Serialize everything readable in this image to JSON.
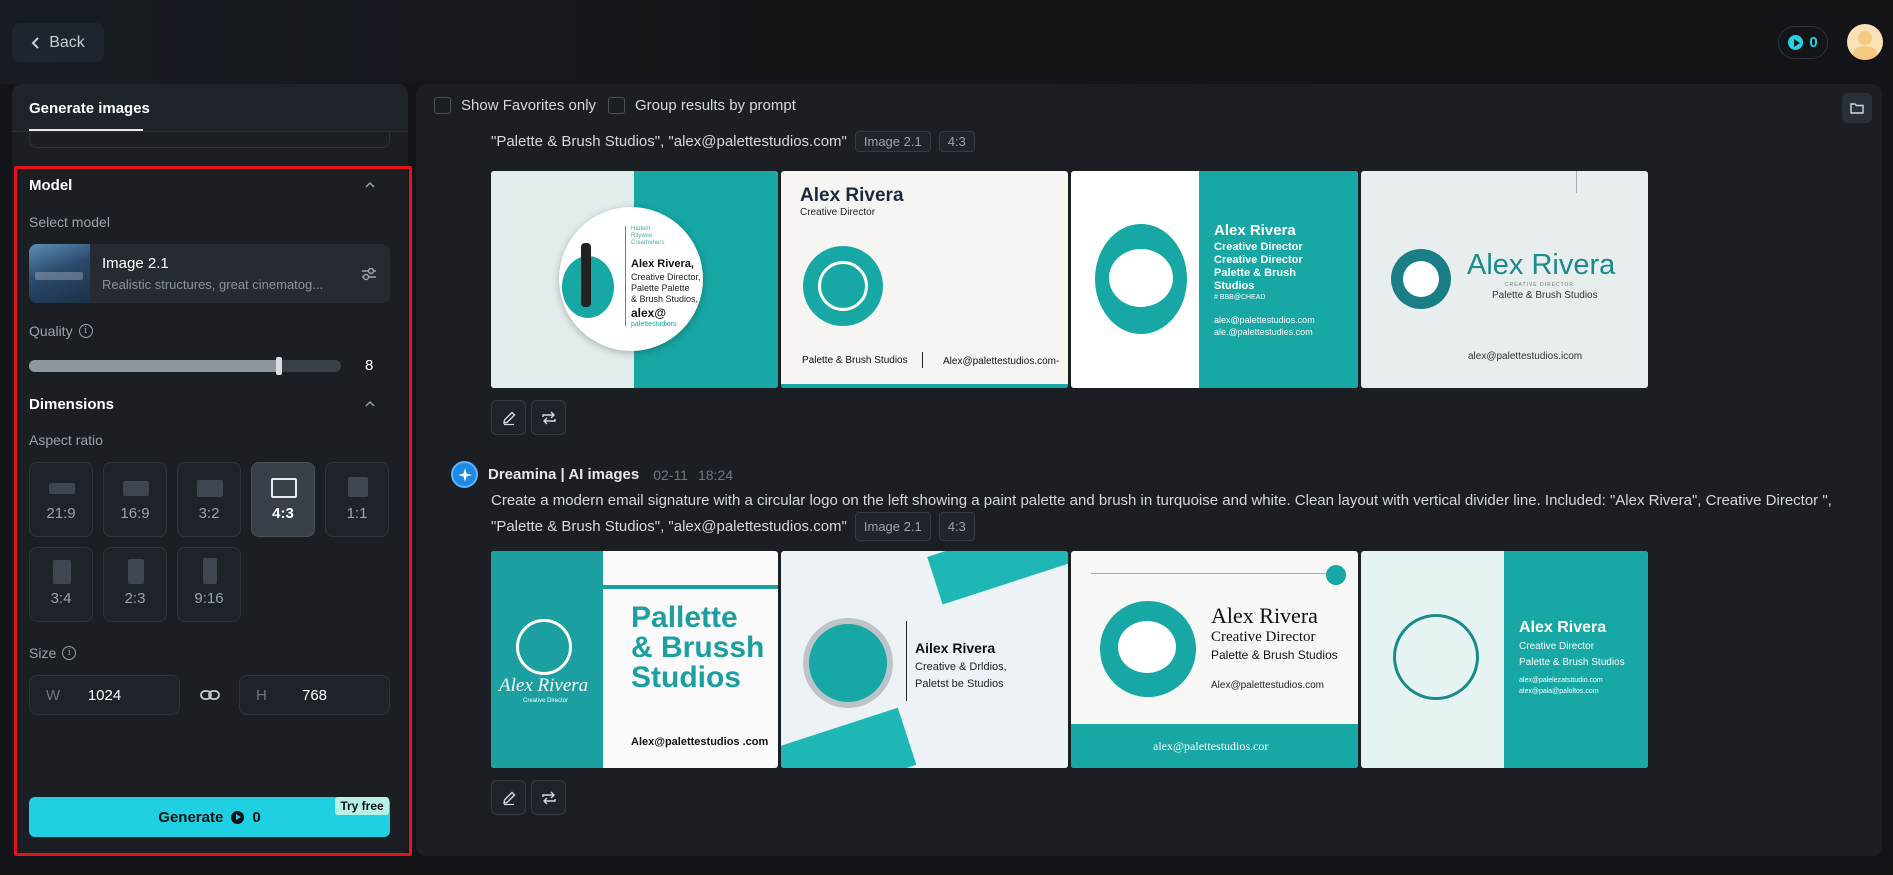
{
  "header": {
    "back_label": "Back",
    "credits": "0"
  },
  "left": {
    "tab_label": "Generate images",
    "model_section": "Model",
    "select_model_label": "Select model",
    "model_name": "Image 2.1",
    "model_desc": "Realistic structures, great cinematog...",
    "quality_label": "Quality",
    "quality_value": "8",
    "quality_fraction": 0.8,
    "dimensions_section": "Dimensions",
    "aspect_label": "Aspect ratio",
    "ratios": [
      "21:9",
      "16:9",
      "3:2",
      "4:3",
      "1:1",
      "3:4",
      "2:3",
      "9:16"
    ],
    "selected_ratio": "4:3",
    "size_label": "Size",
    "width_prefix": "W",
    "width_value": "1024",
    "height_prefix": "H",
    "height_value": "768",
    "generate_label": "Generate",
    "generate_cost": "0",
    "try_free": "Try free"
  },
  "feed": {
    "show_favorites": "Show Favorites only",
    "group_results": "Group results by prompt",
    "batch1": {
      "prompt_tail": "\"Palette & Brush Studios\", \"alex@palettestudios.com\"",
      "model_tag": "Image 2.1",
      "ratio_tag": "4:3"
    },
    "batch2": {
      "author": "Dreamina | AI images",
      "date": "02-11",
      "time": "18:24",
      "prompt_line1": "Create a modern email signature with a circular logo on the left showing a paint palette and brush in turquoise and white. Clean layout with vertical divider line. Included: \"Alex Rivera\", Creative Director \",",
      "prompt_line2": "\"Palette & Brush Studios\", \"alex@palettestudios.com\"",
      "model_tag": "Image 2.1",
      "ratio_tag": "4:3"
    },
    "images1": {
      "a": {
        "name": "Alex Rivera,",
        "l1": "Creative Director,",
        "l2": "Palette Palette",
        "l3": "& Brush Studios,",
        "l4": "alex@",
        "l5": "palettestudiors",
        "small": "Hadem.\nRitywee\nCrearheners."
      },
      "b": {
        "name": "Alex Rivera",
        "role": "Creative Director",
        "studio": "Palette & Brush Studios",
        "email": "Alex@palettestudios.com-"
      },
      "c": {
        "name": "Alex Rivera",
        "l1": "Creative Director",
        "l2": "Creative Director",
        "l3": "Palette & Brush",
        "l4": "Studios",
        "l5": "# BBB@CHEAD",
        "e1": "alex@palettestudios.com",
        "e2": "ale.@palettestudies.com"
      },
      "d": {
        "name": "Alex Rivera",
        "small": "CREATIVE DIRECTOR",
        "studio": "Palette & Brush Studios",
        "email": "alex@palettestudios.icom"
      }
    },
    "images2": {
      "a": {
        "name": "Alex Rivera",
        "role": "Creative Director",
        "big1": "Pallette",
        "big2": "& Brussh",
        "big3": "Studios",
        "email": "Alex@palettestudios .com"
      },
      "b": {
        "name": "Ailex Rivera",
        "l1": "Creative & Drldios,",
        "l2": "Paletst be Studios"
      },
      "c": {
        "name": "Alex Rivera",
        "role": "Creative Director",
        "studio": "Palette & Brush Studios",
        "email1": "Alex@palettestudios.com",
        "email2": "alex@palettestudios.cor"
      },
      "d": {
        "name": "Alex Rivera",
        "role": "Creative Director",
        "studio": "Palette & Brush Studios",
        "e1": "alex@palelezatsttudio.com",
        "e2": "alex@pala@paloltos.com"
      }
    }
  },
  "colors": {
    "accent": "#1fd0e2",
    "teal": "#17a7a4",
    "highlight": "#e0131f"
  }
}
